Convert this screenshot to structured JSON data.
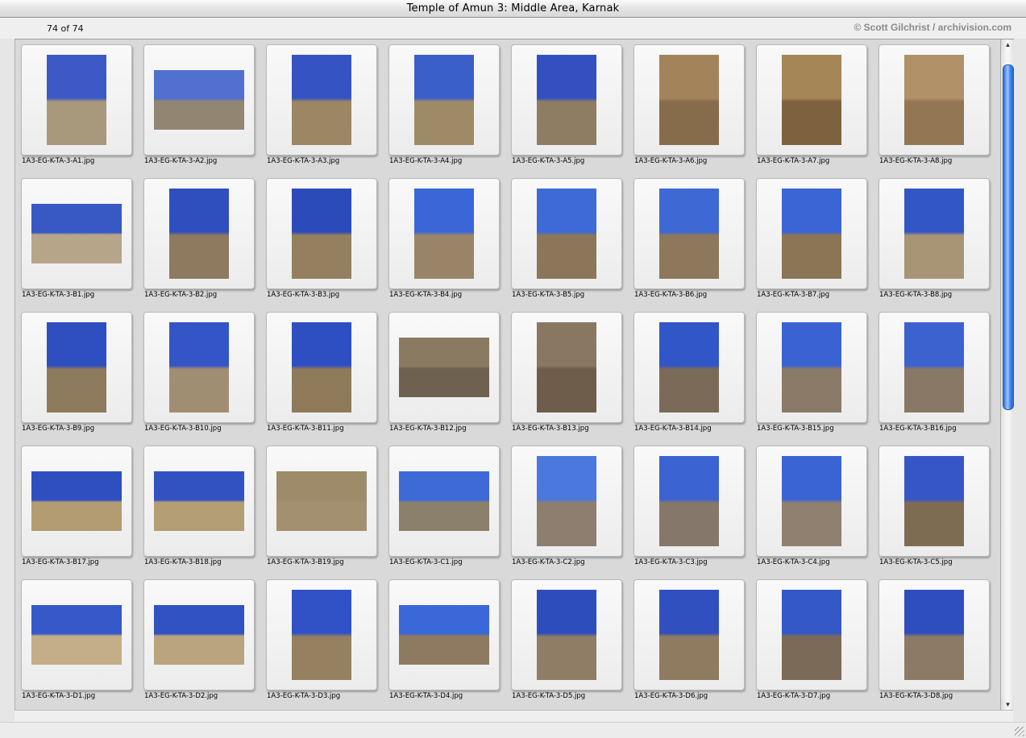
{
  "window": {
    "title": "Temple of Amun 3: Middle Area, Karnak"
  },
  "info": {
    "count": "74 of 74",
    "credit": "© Scott Gilchrist / archivision.com"
  },
  "scroll": {
    "position": 0.0
  },
  "thumbnails": [
    {
      "name": "1A3-EG-K-TA-3-A1.jpg",
      "orient": "portrait",
      "sky": "#3d59c6",
      "ground": "#a8987c"
    },
    {
      "name": "1A3-EG-K-TA-3-A2.jpg",
      "orient": "landscape",
      "sky": "#5170cf",
      "ground": "#928672"
    },
    {
      "name": "1A3-EG-K-TA-3-A3.jpg",
      "orient": "portrait",
      "sky": "#3553c2",
      "ground": "#9c8663"
    },
    {
      "name": "1A3-EG-K-TA-3-A4.jpg",
      "orient": "portrait",
      "sky": "#3b5fc9",
      "ground": "#9f8a68"
    },
    {
      "name": "1A3-EG-K-TA-3-A5.jpg",
      "orient": "portrait",
      "sky": "#3450c0",
      "ground": "#8f7d63"
    },
    {
      "name": "1A3-EG-K-TA-3-A6.jpg",
      "orient": "portrait",
      "sky": "#a3845a",
      "ground": "#866c4a"
    },
    {
      "name": "1A3-EG-K-TA-3-A7.jpg",
      "orient": "portrait",
      "sky": "#a58656",
      "ground": "#7e6240"
    },
    {
      "name": "1A3-EG-K-TA-3-A8.jpg",
      "orient": "portrait",
      "sky": "#b09168",
      "ground": "#937654"
    },
    {
      "name": "1A3-EG-K-TA-3-B1.jpg",
      "orient": "landscape",
      "sky": "#3858c4",
      "ground": "#b7a58a"
    },
    {
      "name": "1A3-EG-K-TA-3-B2.jpg",
      "orient": "portrait",
      "sky": "#2f4fbf",
      "ground": "#8d7a5f"
    },
    {
      "name": "1A3-EG-K-TA-3-B3.jpg",
      "orient": "portrait",
      "sky": "#2c4bbb",
      "ground": "#94805f"
    },
    {
      "name": "1A3-EG-K-TA-3-B4.jpg",
      "orient": "portrait",
      "sky": "#3b66d8",
      "ground": "#9a8468"
    },
    {
      "name": "1A3-EG-K-TA-3-B5.jpg",
      "orient": "portrait",
      "sky": "#3d6ad6",
      "ground": "#8c7659"
    },
    {
      "name": "1A3-EG-K-TA-3-B6.jpg",
      "orient": "portrait",
      "sky": "#3e68d4",
      "ground": "#8d785c"
    },
    {
      "name": "1A3-EG-K-TA-3-B7.jpg",
      "orient": "portrait",
      "sky": "#3b64d4",
      "ground": "#8b7555"
    },
    {
      "name": "1A3-EG-K-TA-3-B8.jpg",
      "orient": "portrait",
      "sky": "#3356c6",
      "ground": "#a89576"
    },
    {
      "name": "1A3-EG-K-TA-3-B9.jpg",
      "orient": "portrait",
      "sky": "#2f4fc0",
      "ground": "#8e7b5e"
    },
    {
      "name": "1A3-EG-K-TA-3-B10.jpg",
      "orient": "portrait",
      "sky": "#3455c8",
      "ground": "#a08e72"
    },
    {
      "name": "1A3-EG-K-TA-3-B11.jpg",
      "orient": "portrait",
      "sky": "#2e4fc2",
      "ground": "#8f7a5a"
    },
    {
      "name": "1A3-EG-K-TA-3-B12.jpg",
      "orient": "landscape",
      "sky": "#8b7a62",
      "ground": "#6f614f"
    },
    {
      "name": "1A3-EG-K-TA-3-B13.jpg",
      "orient": "portrait",
      "sky": "#8a7762",
      "ground": "#6e5d4b"
    },
    {
      "name": "1A3-EG-K-TA-3-B14.jpg",
      "orient": "portrait",
      "sky": "#3156c7",
      "ground": "#7b6a58"
    },
    {
      "name": "1A3-EG-K-TA-3-B15.jpg",
      "orient": "portrait",
      "sky": "#3a62d2",
      "ground": "#8c7a68"
    },
    {
      "name": "1A3-EG-K-TA-3-B16.jpg",
      "orient": "portrait",
      "sky": "#3c62d0",
      "ground": "#8a7866"
    },
    {
      "name": "1A3-EG-K-TA-3-B17.jpg",
      "orient": "landscape",
      "sky": "#2f4fc0",
      "ground": "#b39c72"
    },
    {
      "name": "1A3-EG-K-TA-3-B18.jpg",
      "orient": "landscape",
      "sky": "#3352c2",
      "ground": "#b49e74"
    },
    {
      "name": "1A3-EG-K-TA-3-B19.jpg",
      "orient": "landscape",
      "sky": "#9d8b6a",
      "ground": "#a39070"
    },
    {
      "name": "1A3-EG-K-TA-3-C1.jpg",
      "orient": "landscape",
      "sky": "#3e6ad8",
      "ground": "#8b806c"
    },
    {
      "name": "1A3-EG-K-TA-3-C2.jpg",
      "orient": "portrait",
      "sky": "#4a78dc",
      "ground": "#8e7e70"
    },
    {
      "name": "1A3-EG-K-TA-3-C3.jpg",
      "orient": "portrait",
      "sky": "#3b63d1",
      "ground": "#85776a"
    },
    {
      "name": "1A3-EG-K-TA-3-C4.jpg",
      "orient": "portrait",
      "sky": "#3a64d4",
      "ground": "#8f8070"
    },
    {
      "name": "1A3-EG-K-TA-3-C5.jpg",
      "orient": "portrait",
      "sky": "#3656c8",
      "ground": "#7e6c52"
    },
    {
      "name": "1A3-EG-K-TA-3-D1.jpg",
      "orient": "landscape",
      "sky": "#3658c8",
      "ground": "#c4ae88"
    },
    {
      "name": "1A3-EG-K-TA-3-D2.jpg",
      "orient": "landscape",
      "sky": "#3152c2",
      "ground": "#b9a47e"
    },
    {
      "name": "1A3-EG-K-TA-3-D3.jpg",
      "orient": "portrait",
      "sky": "#3052c6",
      "ground": "#95805f"
    },
    {
      "name": "1A3-EG-K-TA-3-D4.jpg",
      "orient": "landscape",
      "sky": "#3b68d8",
      "ground": "#8d7a60"
    },
    {
      "name": "1A3-EG-K-TA-3-D5.jpg",
      "orient": "portrait",
      "sky": "#2e4dbd",
      "ground": "#8f7d65"
    },
    {
      "name": "1A3-EG-K-TA-3-D6.jpg",
      "orient": "portrait",
      "sky": "#3050c0",
      "ground": "#8e7b60"
    },
    {
      "name": "1A3-EG-K-TA-3-D7.jpg",
      "orient": "portrait",
      "sky": "#3458c8",
      "ground": "#7b6a58"
    },
    {
      "name": "1A3-EG-K-TA-3-D8.jpg",
      "orient": "portrait",
      "sky": "#2e4ec0",
      "ground": "#8c7a64"
    }
  ]
}
